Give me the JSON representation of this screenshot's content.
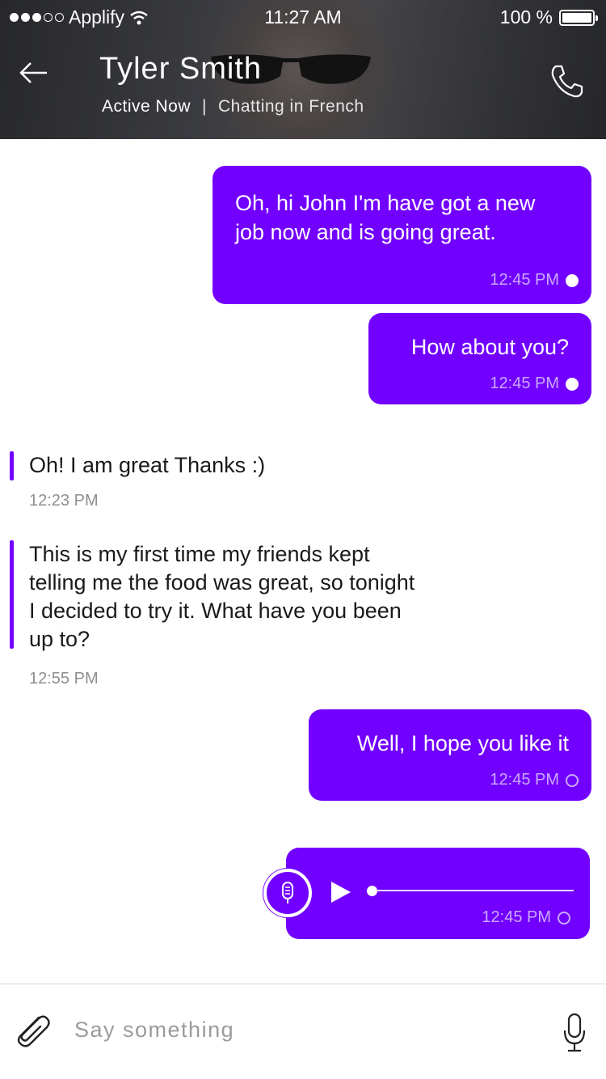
{
  "status_bar": {
    "carrier": "Applify",
    "time": "11:27 AM",
    "battery": "100 %",
    "signal_bars_filled": 3,
    "signal_bars_total": 5
  },
  "header": {
    "contact_name": "Tyler Smith",
    "status": "Active Now",
    "separator": "|",
    "chat_language": "Chatting in French"
  },
  "messages": [
    {
      "direction": "outgoing",
      "text_line1": "Oh, hi John I'm have got a new",
      "text_line2": "job now and is going great.",
      "time": "12:45 PM",
      "read": true
    },
    {
      "direction": "outgoing",
      "text": "How about you?",
      "time": "12:45 PM",
      "read": true
    },
    {
      "direction": "incoming",
      "text": "Oh! I am great Thanks :)",
      "time": "12:23 PM"
    },
    {
      "direction": "incoming",
      "text_lines": [
        "This is my first time my friends kept",
        "telling me the food was great, so tonight",
        "I decided to try it. What have you been",
        "up to?"
      ],
      "time": "12:55 PM"
    },
    {
      "direction": "outgoing",
      "text": "Well, I hope you like it",
      "time": "12:45 PM",
      "read": false
    },
    {
      "direction": "outgoing",
      "type": "voice",
      "time": "12:45 PM",
      "read": false,
      "playback_progress": 0
    }
  ],
  "composer": {
    "placeholder": "Say something"
  },
  "colors": {
    "accent": "#7200ff",
    "bubble_text": "#ffffff",
    "meta_text": "#c9a9ff",
    "incoming_time": "#8f8f8f"
  },
  "icons": {
    "back": "arrow-left-icon",
    "call": "phone-icon",
    "attach": "paperclip-icon",
    "mic": "microphone-icon",
    "play": "play-icon"
  }
}
